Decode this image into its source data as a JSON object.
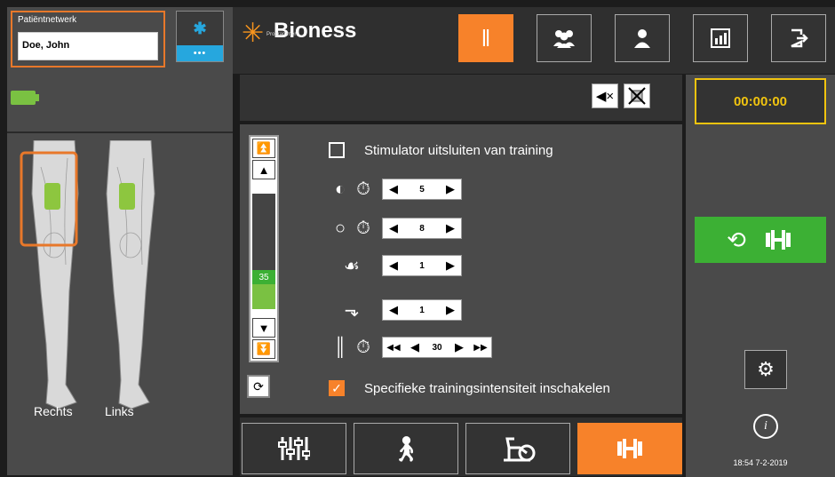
{
  "patient": {
    "label": "Patiëntnetwerk",
    "name": "Doe, John"
  },
  "bluetooth": {
    "icon": "bluetooth-icon",
    "dots": "•••"
  },
  "battery": {
    "icon": "battery-icon",
    "color": "#7ac142"
  },
  "legs": {
    "right_label": "Rechts",
    "left_label": "Links"
  },
  "logo": {
    "name": "Bioness",
    "sub": "Programmer"
  },
  "header_buttons": [
    {
      "icon": "legs-icon",
      "active": true
    },
    {
      "icon": "patients-group-icon",
      "active": false
    },
    {
      "icon": "patient-icon",
      "active": false
    },
    {
      "icon": "reports-icon",
      "active": false
    },
    {
      "icon": "exit-icon",
      "active": false
    }
  ],
  "message_bar": {
    "mute_icon": "mute-icon",
    "stim_icon": "stimulation-off-icon"
  },
  "intensity": {
    "value": "35",
    "level_fraction": 0.25
  },
  "training": {
    "exclude_label": "Stimulator uitsluiten van training",
    "exclude_checked": false,
    "rows": [
      {
        "icon": "wave-timer-icon",
        "value": "5"
      },
      {
        "icon": "circle-timer-icon",
        "value": "8"
      },
      {
        "icon": "heel-off-icon",
        "value": "1"
      },
      {
        "icon": "heel-strike-icon",
        "value": "1"
      }
    ],
    "exercise_value": "30",
    "specific_label": "Specifieke trainingsintensiteit inschakelen",
    "specific_checked": true
  },
  "tabs": [
    {
      "icon": "sliders-icon",
      "active": false
    },
    {
      "icon": "walking-icon",
      "active": false
    },
    {
      "icon": "exercise-bike-icon",
      "active": false
    },
    {
      "icon": "dumbbell-icon",
      "active": true
    }
  ],
  "right_panel": {
    "timer": "00:00:00",
    "history_icon": "history-icon",
    "dumbbell_icon": "dumbbell-icon",
    "settings_icon": "gear-icon",
    "info_icon": "info-icon",
    "clock": "18:54 7-2-2019"
  },
  "colors": {
    "accent": "#f7822a",
    "green": "#3cb034",
    "blue": "#26a7de",
    "timer": "#f1c40f"
  }
}
